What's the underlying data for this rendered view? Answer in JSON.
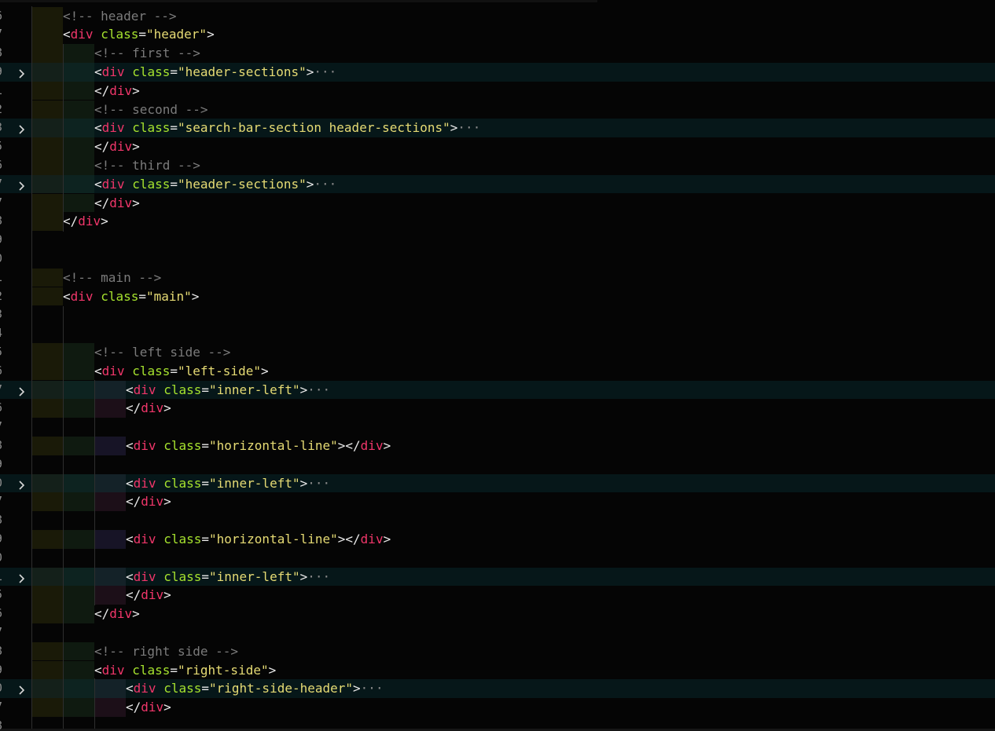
{
  "editor": {
    "colors": {
      "background": "#050505",
      "tag": "#f0366a",
      "attribute": "#a6e22e",
      "string": "#e6db74",
      "comment": "#7b7b7b",
      "folded_line_bg": "#061719"
    },
    "fold_icon": "chevron-right-icon",
    "ellipsis": "···",
    "lines": [
      {
        "num": "6",
        "depth": 1,
        "comment": "<!-- header -->"
      },
      {
        "num": "7",
        "depth": 1,
        "tag": "div",
        "cls": "header"
      },
      {
        "num": "8",
        "depth": 2,
        "comment": "<!-- first -->"
      },
      {
        "num": "9",
        "depth": 2,
        "tag": "div",
        "cls": "header-sections",
        "folded": true
      },
      {
        "num": "1",
        "depth": 2,
        "close": "div"
      },
      {
        "num": "2",
        "depth": 2,
        "comment": "<!-- second -->"
      },
      {
        "num": "3",
        "depth": 2,
        "tag": "div",
        "cls": "search-bar-section header-sections",
        "folded": true
      },
      {
        "num": "5",
        "depth": 2,
        "close": "div"
      },
      {
        "num": "6",
        "depth": 2,
        "comment": "<!-- third -->"
      },
      {
        "num": "7",
        "depth": 2,
        "tag": "div",
        "cls": "header-sections",
        "folded": true
      },
      {
        "num": "7",
        "depth": 2,
        "close": "div"
      },
      {
        "num": "8",
        "depth": 1,
        "close": "div"
      },
      {
        "num": "9",
        "depth": 0,
        "blank": true
      },
      {
        "num": "0",
        "depth": 0,
        "blank": true
      },
      {
        "num": "1",
        "depth": 1,
        "comment": "<!-- main -->"
      },
      {
        "num": "2",
        "depth": 1,
        "tag": "div",
        "cls": "main"
      },
      {
        "num": "3",
        "depth": 0,
        "blank": true
      },
      {
        "num": "4",
        "depth": 0,
        "blank": true
      },
      {
        "num": "5",
        "depth": 2,
        "comment": "<!-- left side -->"
      },
      {
        "num": "6",
        "depth": 2,
        "tag": "div",
        "cls": "left-side"
      },
      {
        "num": "7",
        "depth": 3,
        "tag": "div",
        "cls": "inner-left",
        "folded": true
      },
      {
        "num": "6",
        "depth": 3,
        "close": "div"
      },
      {
        "num": "7",
        "depth": 0,
        "blank": true
      },
      {
        "num": "8",
        "depth": 3,
        "tag": "div",
        "cls": "horizontal-line",
        "selfclose": "div"
      },
      {
        "num": "9",
        "depth": 0,
        "blank": true
      },
      {
        "num": "0",
        "depth": 3,
        "tag": "div",
        "cls": "inner-left",
        "folded": true
      },
      {
        "num": "7",
        "depth": 3,
        "close": "div"
      },
      {
        "num": "8",
        "depth": 0,
        "blank": true
      },
      {
        "num": "9",
        "depth": 3,
        "tag": "div",
        "cls": "horizontal-line",
        "selfclose": "div"
      },
      {
        "num": "0",
        "depth": 0,
        "blank": true
      },
      {
        "num": "1",
        "depth": 3,
        "tag": "div",
        "cls": "inner-left",
        "folded": true
      },
      {
        "num": "5",
        "depth": 3,
        "close": "div"
      },
      {
        "num": "6",
        "depth": 2,
        "close": "div"
      },
      {
        "num": "7",
        "depth": 0,
        "blank": true
      },
      {
        "num": "8",
        "depth": 2,
        "comment": "<!-- right side -->"
      },
      {
        "num": "9",
        "depth": 2,
        "tag": "div",
        "cls": "right-side"
      },
      {
        "num": "0",
        "depth": 3,
        "tag": "div",
        "cls": "right-side-header",
        "folded": true
      },
      {
        "num": "7",
        "depth": 3,
        "close": "div"
      },
      {
        "num": "8",
        "depth": 0,
        "blank": true
      }
    ]
  }
}
